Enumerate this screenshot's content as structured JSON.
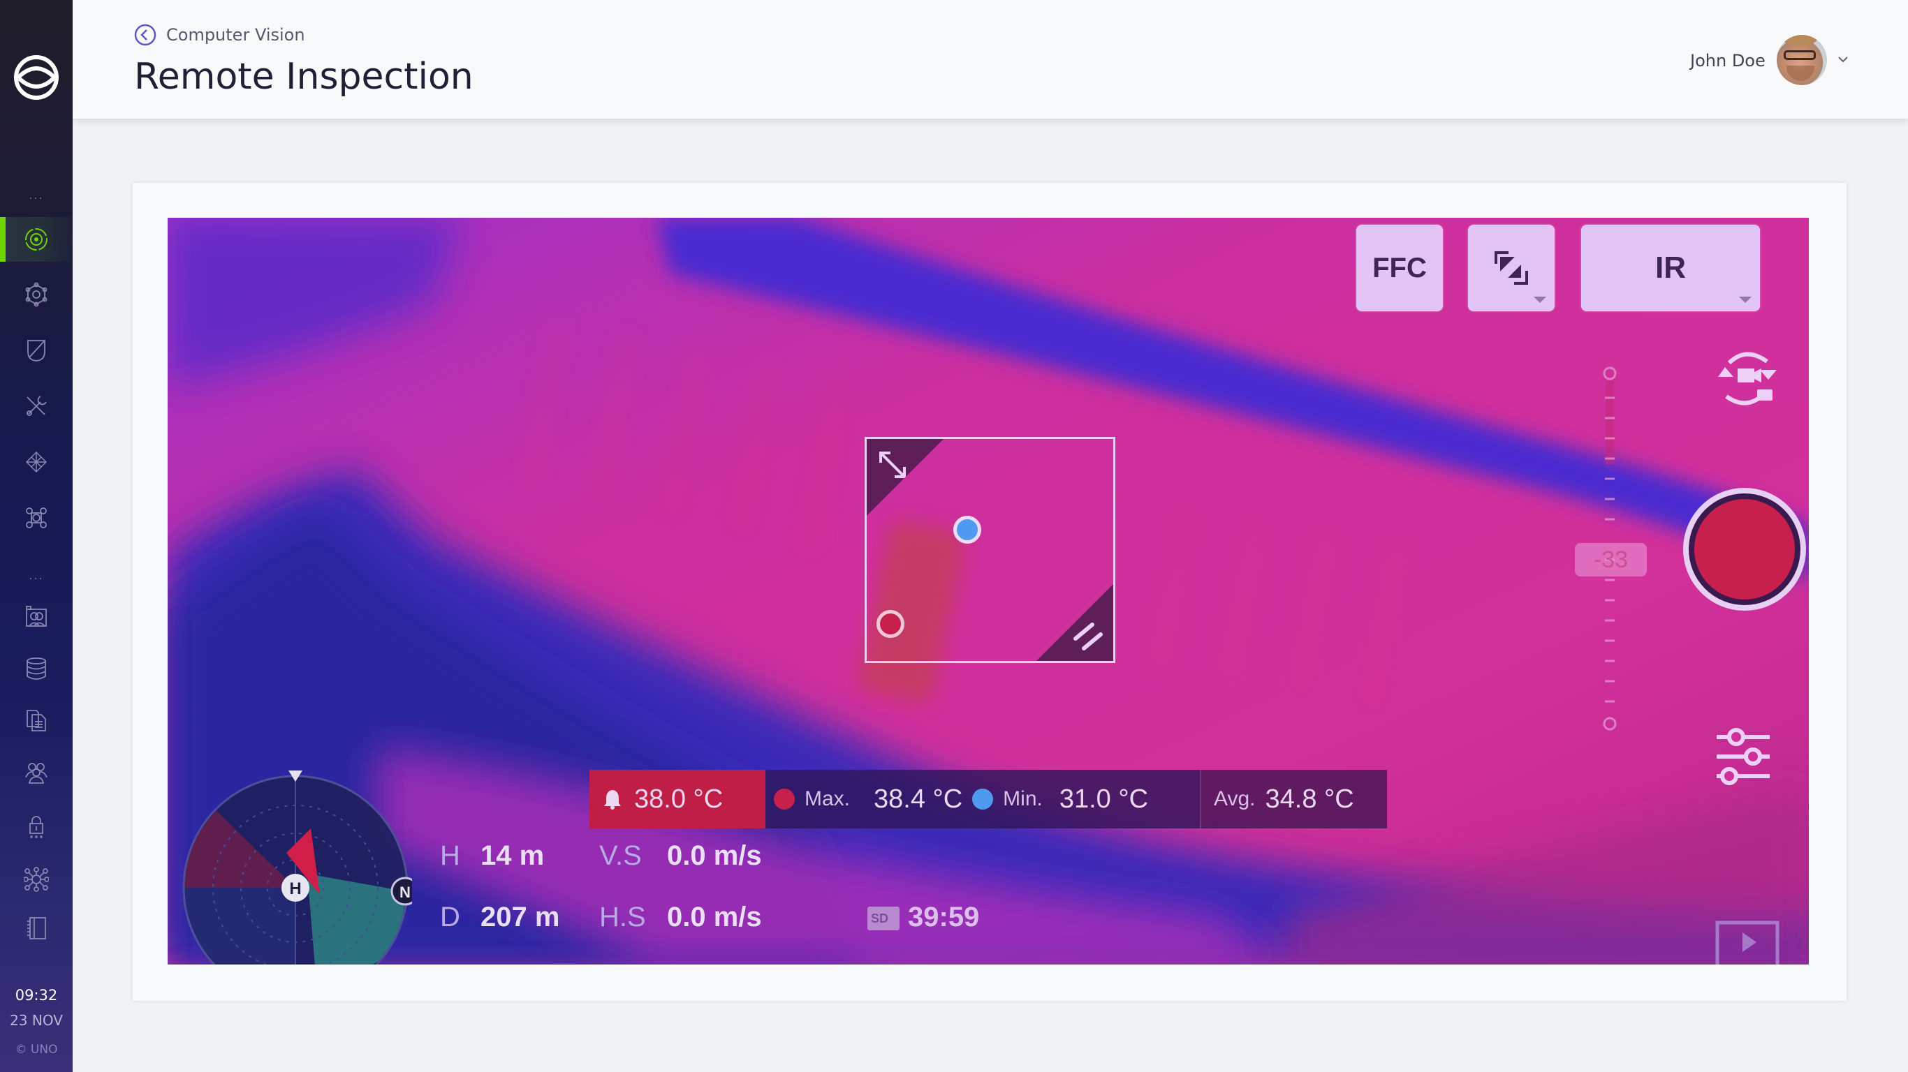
{
  "sidebar": {
    "logo": "uno-logo",
    "group_separator": "...",
    "items_top": [
      {
        "name": "vision-icon",
        "active": true
      },
      {
        "name": "network-settings-icon",
        "active": false
      },
      {
        "name": "shield-icon",
        "active": false
      },
      {
        "name": "tools-icon",
        "active": false
      },
      {
        "name": "mesh-icon",
        "active": false
      },
      {
        "name": "command-icon",
        "active": false
      }
    ],
    "items_bottom": [
      {
        "name": "gallery-icon"
      },
      {
        "name": "database-icon"
      },
      {
        "name": "documents-icon"
      },
      {
        "name": "users-icon"
      },
      {
        "name": "lock-icon"
      },
      {
        "name": "hub-icon"
      },
      {
        "name": "notebook-icon"
      }
    ],
    "accent_color": "#6fd400",
    "clock": {
      "time": "09:32",
      "date": "23 NOV"
    },
    "copyright": "© UNO"
  },
  "header": {
    "breadcrumb": "Computer Vision",
    "title": "Remote Inspection",
    "user": {
      "name": "John Doe"
    }
  },
  "video": {
    "buttons": {
      "ffc": "FFC",
      "crop": "crop-icon",
      "mode": "IR"
    },
    "zoom_value": "-33",
    "record_color": "#c8204c",
    "temperature": {
      "alarm": "38.0 °C",
      "max_label": "Max.",
      "max": "38.4 °C",
      "min_label": "Min.",
      "min": "31.0 °C",
      "avg_label": "Avg.",
      "avg": "34.8 °C",
      "max_color": "#c8204c",
      "min_color": "#4f9af0"
    },
    "telemetry": {
      "height_label": "H",
      "height": "14 m",
      "distance_label": "D",
      "distance": "207 m",
      "vs_label": "V.S",
      "vs": "0.0 m/s",
      "hs_label": "H.S",
      "hs": "0.0 m/s",
      "sd_label": "SD",
      "record_time": "39:59"
    },
    "compass": {
      "home": "H",
      "north": "N"
    }
  }
}
